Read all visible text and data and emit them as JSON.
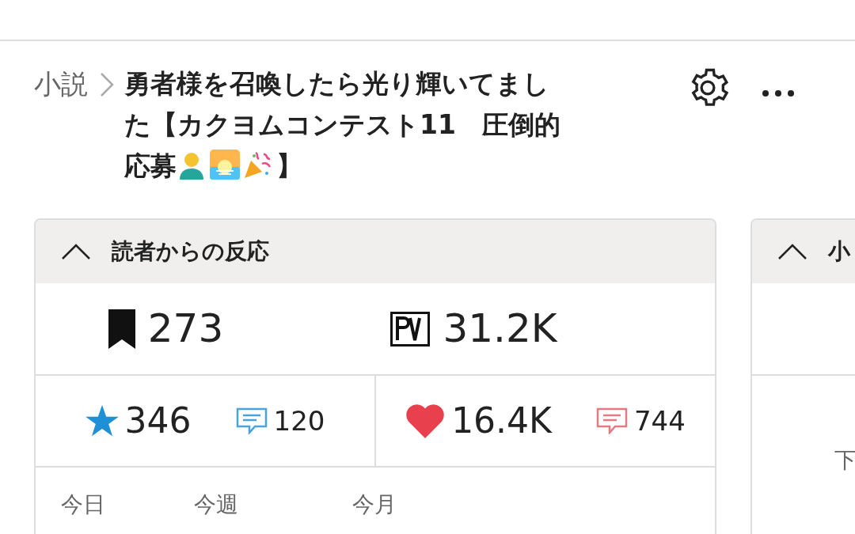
{
  "breadcrumb": {
    "category": "小説",
    "title_lines": [
      "勇者様を召喚したら光り輝いてまし",
      "た【カクヨムコンテスト11　圧倒的",
      "応募"
    ],
    "title_end": "】"
  },
  "reactions_card": {
    "heading": "読者からの反応",
    "expanded": true,
    "bookmarks": "273",
    "pv": "31.2K",
    "stars": "346",
    "star_comments": "120",
    "hearts": "16.4K",
    "heart_comments": "744",
    "periods": [
      "今日",
      "今週",
      "今月"
    ]
  },
  "second_card": {
    "heading": "小",
    "expanded": true,
    "label": "下"
  }
}
